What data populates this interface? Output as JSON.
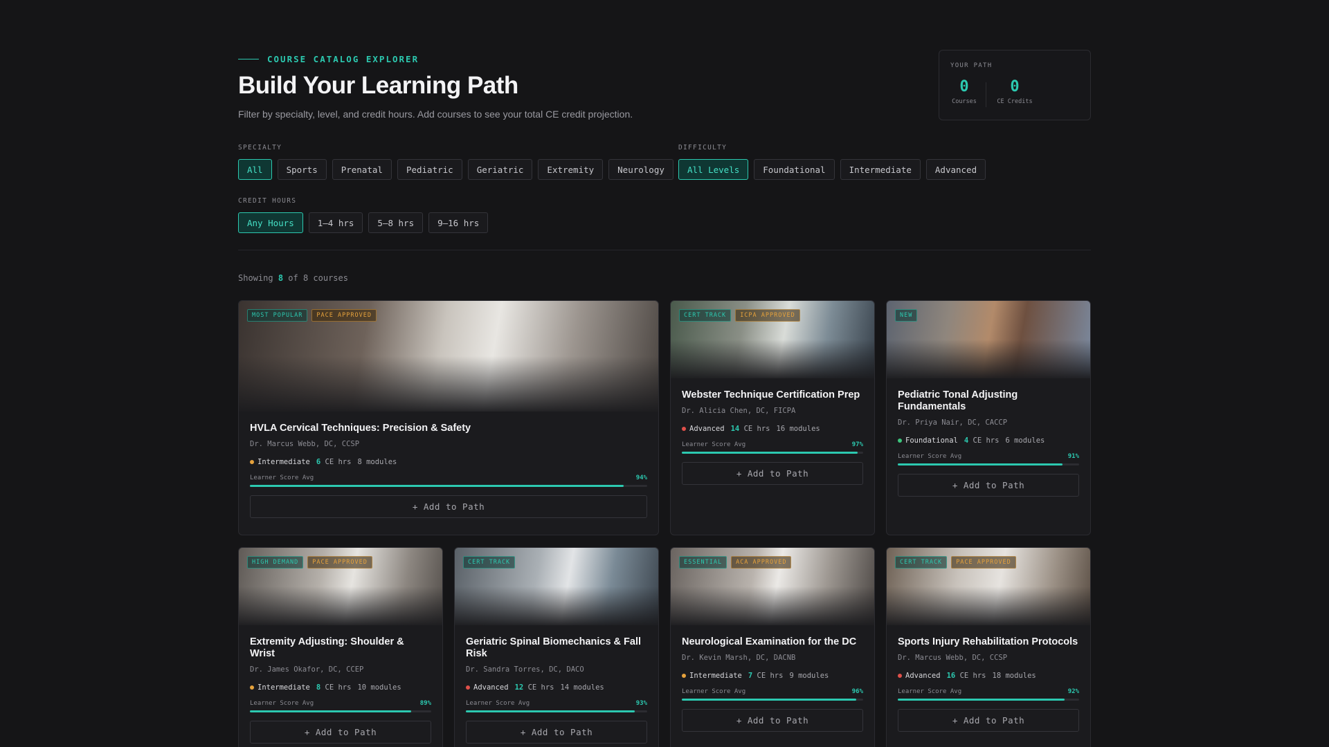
{
  "header": {
    "eyebrow": "COURSE CATALOG EXPLORER",
    "title": "Build Your Learning Path",
    "subtitle": "Filter by specialty, level, and credit hours. Add courses to see your total CE credit projection."
  },
  "path": {
    "label": "YOUR PATH",
    "courses_value": "0",
    "courses_label": "Courses",
    "credits_value": "0",
    "credits_label": "CE Credits"
  },
  "filters": {
    "specialty_label": "SPECIALTY",
    "specialty": [
      "All",
      "Sports",
      "Prenatal",
      "Pediatric",
      "Geriatric",
      "Extremity",
      "Neurology"
    ],
    "difficulty_label": "DIFFICULTY",
    "difficulty": [
      "All Levels",
      "Foundational",
      "Intermediate",
      "Advanced"
    ],
    "hours_label": "CREDIT HOURS",
    "hours": [
      "Any Hours",
      "1–4 hrs",
      "5–8 hrs",
      "9–16 hrs"
    ]
  },
  "showing": {
    "prefix": "Showing",
    "count": "8",
    "suffix": "of 8 courses"
  },
  "colors": {
    "accent": "#2cc9b0",
    "intermediate": "#e6a23c",
    "advanced": "#e0504a",
    "foundational": "#3cc47c"
  },
  "courses": [
    {
      "title": "HVLA Cervical Techniques: Precision & Safety",
      "instructor": "Dr. Marcus Webb, DC, CCSP",
      "badges": [
        "MOST POPULAR",
        "PACE APPROVED"
      ],
      "level": "Intermediate",
      "ce": "6",
      "ce_unit": "CE hrs",
      "modules": "8 modules",
      "score_label": "Learner Score Avg",
      "score": "94%",
      "add_label": "+ Add to Path"
    },
    {
      "title": "Webster Technique Certification Prep",
      "instructor": "Dr. Alicia Chen, DC, FICPA",
      "badges": [
        "CERT TRACK",
        "ICPA APPROVED"
      ],
      "level": "Advanced",
      "ce": "14",
      "ce_unit": "CE hrs",
      "modules": "16 modules",
      "score_label": "Learner Score Avg",
      "score": "97%",
      "add_label": "+ Add to Path"
    },
    {
      "title": "Pediatric Tonal Adjusting Fundamentals",
      "instructor": "Dr. Priya Nair, DC, CACCP",
      "badges": [
        "NEW"
      ],
      "level": "Foundational",
      "ce": "4",
      "ce_unit": "CE hrs",
      "modules": "6 modules",
      "score_label": "Learner Score Avg",
      "score": "91%",
      "add_label": "+ Add to Path"
    },
    {
      "title": "Extremity Adjusting: Shoulder & Wrist",
      "instructor": "Dr. James Okafor, DC, CCEP",
      "badges": [
        "HIGH DEMAND",
        "PACE APPROVED"
      ],
      "level": "Intermediate",
      "ce": "8",
      "ce_unit": "CE hrs",
      "modules": "10 modules",
      "score_label": "Learner Score Avg",
      "score": "89%",
      "add_label": "+ Add to Path"
    },
    {
      "title": "Geriatric Spinal Biomechanics & Fall Risk",
      "instructor": "Dr. Sandra Torres, DC, DACO",
      "badges": [
        "CERT TRACK"
      ],
      "level": "Advanced",
      "ce": "12",
      "ce_unit": "CE hrs",
      "modules": "14 modules",
      "score_label": "Learner Score Avg",
      "score": "93%",
      "add_label": "+ Add to Path"
    },
    {
      "title": "Neurological Examination for the DC",
      "instructor": "Dr. Kevin Marsh, DC, DACNB",
      "badges": [
        "ESSENTIAL",
        "ACA APPROVED"
      ],
      "level": "Intermediate",
      "ce": "7",
      "ce_unit": "CE hrs",
      "modules": "9 modules",
      "score_label": "Learner Score Avg",
      "score": "96%",
      "add_label": "+ Add to Path"
    },
    {
      "title": "Sports Injury Rehabilitation Protocols",
      "instructor": "Dr. Marcus Webb, DC, CCSP",
      "badges": [
        "CERT TRACK",
        "PACE APPROVED"
      ],
      "level": "Advanced",
      "ce": "16",
      "ce_unit": "CE hrs",
      "modules": "18 modules",
      "score_label": "Learner Score Avg",
      "score": "92%",
      "add_label": "+ Add to Path"
    }
  ]
}
